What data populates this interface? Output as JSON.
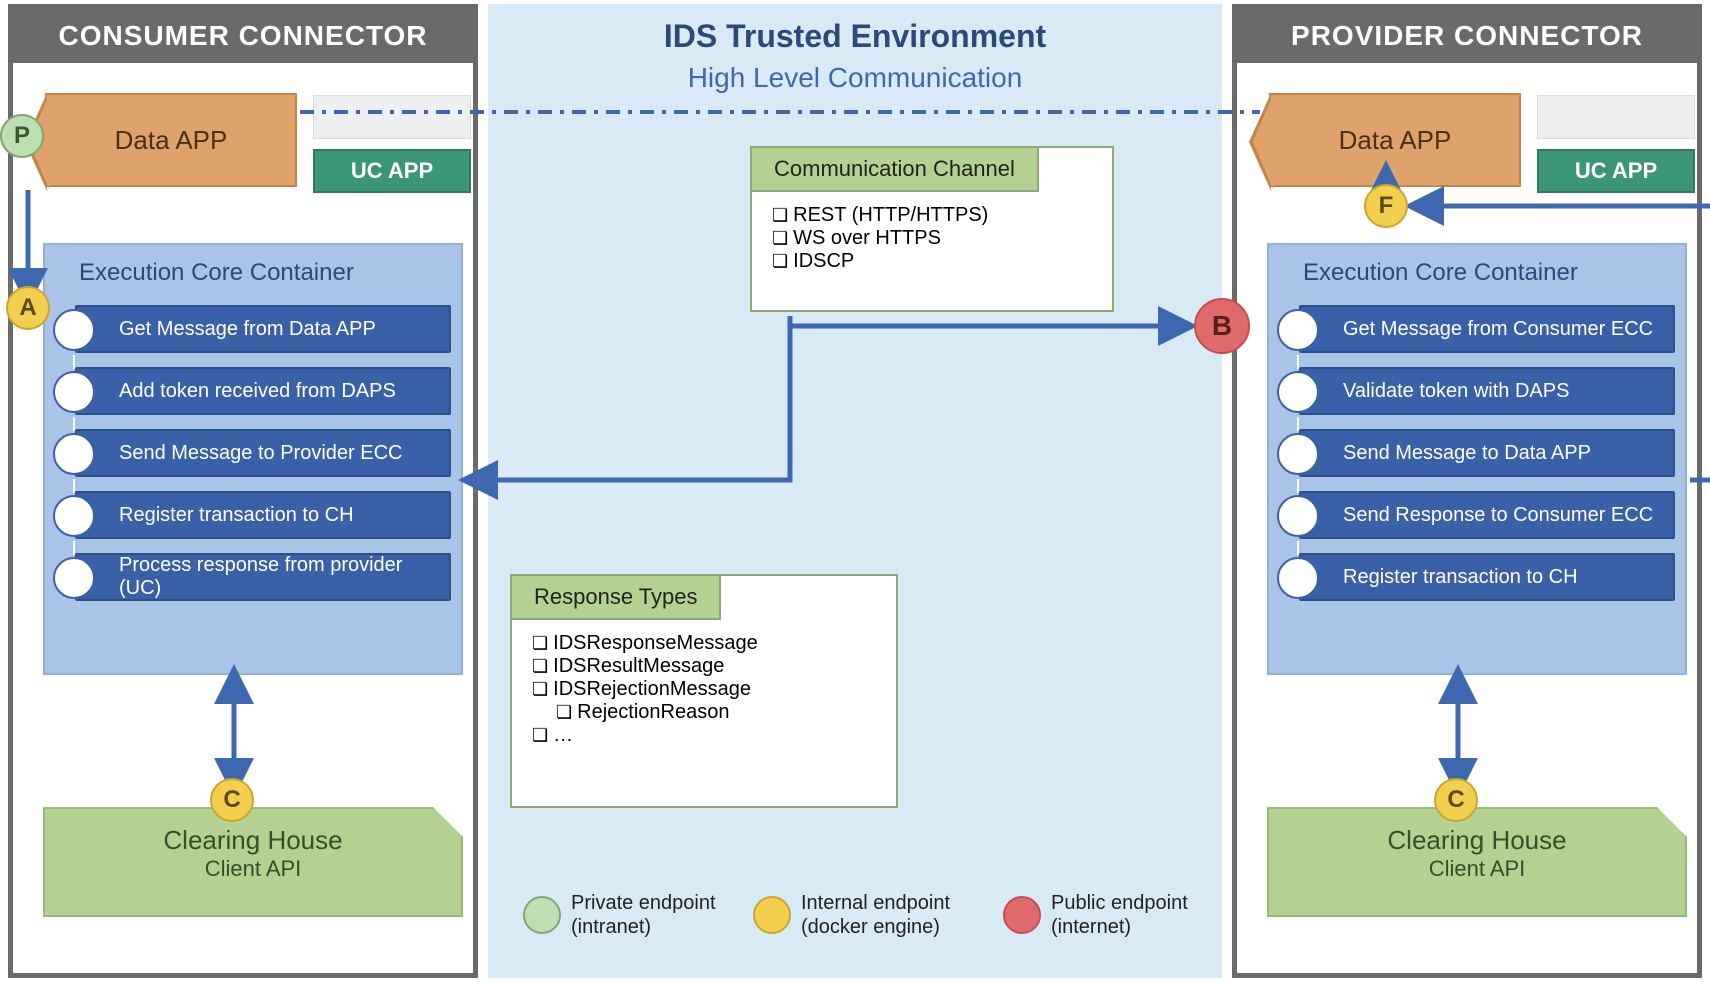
{
  "environment": {
    "title": "IDS Trusted Environment",
    "subtitle": "High Level Communication"
  },
  "connectors": {
    "consumer": {
      "header": "CONSUMER CONNECTOR",
      "data_app": "Data APP",
      "uc_app": "UC APP",
      "ecc_title": "Execution Core Container",
      "steps": [
        "Get Message from Data APP",
        "Add token received from DAPS",
        "Send Message to Provider ECC",
        "Register transaction to CH",
        "Process response from provider (UC)"
      ],
      "clearing": {
        "line1": "Clearing House",
        "line2": "Client API"
      }
    },
    "provider": {
      "header": "PROVIDER CONNECTOR",
      "data_app": "Data APP",
      "uc_app": "UC APP",
      "ecc_title": "Execution Core Container",
      "steps": [
        "Get Message from Consumer ECC",
        "Validate token with DAPS",
        "Send Message to Data APP",
        "Send Response to Consumer ECC",
        "Register transaction to CH"
      ],
      "clearing": {
        "line1": "Clearing House",
        "line2": "Client API"
      }
    }
  },
  "comm_channel": {
    "header": "Communication Channel",
    "items": [
      "REST (HTTP/HTTPS)",
      "WS over HTTPS",
      "IDSCP"
    ]
  },
  "response_types": {
    "header": "Response Types",
    "items": [
      "IDSResponseMessage",
      "IDSResultMessage",
      "IDSRejectionMessage"
    ],
    "sub": "RejectionReason",
    "more": "…"
  },
  "legend": {
    "private": "Private endpoint (intranet)",
    "internal": "Internal endpoint (docker engine)",
    "public": "Public endpoint (internet)"
  },
  "badges": {
    "P": "P",
    "A": "A",
    "B": "B",
    "F": "F",
    "C": "C"
  }
}
